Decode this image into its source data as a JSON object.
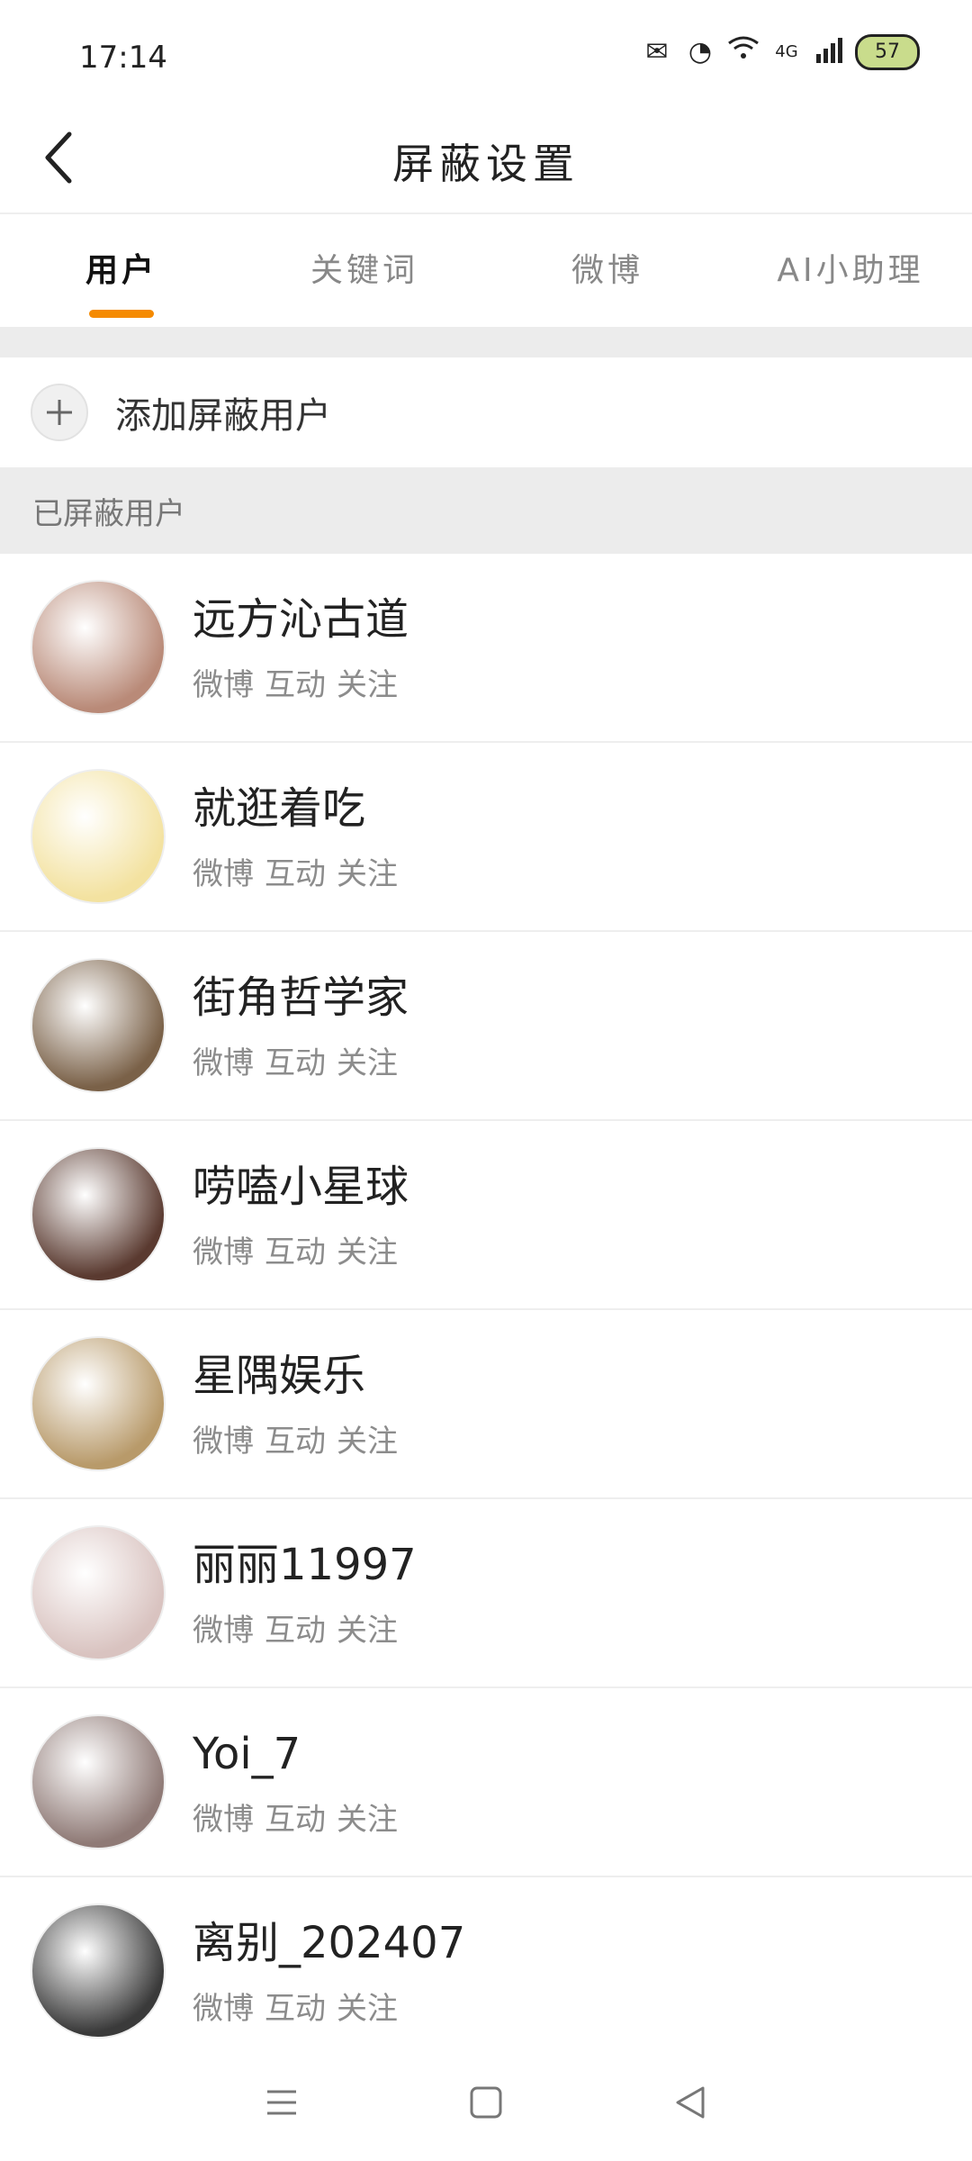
{
  "status_bar": {
    "time": "17:14",
    "network": "4G",
    "battery": "57",
    "icons": [
      "notification-icon",
      "app-icon",
      "wifi-icon",
      "signal-icon",
      "battery-icon"
    ]
  },
  "header": {
    "title": "屏蔽设置",
    "back_icon": "chevron-left-icon"
  },
  "tabs": [
    {
      "label": "用户",
      "active": true
    },
    {
      "label": "关键词",
      "active": false
    },
    {
      "label": "微博",
      "active": false
    },
    {
      "label": "AI小助理",
      "active": false
    }
  ],
  "add_user": {
    "label": "添加屏蔽用户",
    "icon": "plus-icon"
  },
  "section": {
    "title": "已屏蔽用户"
  },
  "blocked_users": [
    {
      "name": "远方沁古道",
      "tags": [
        "微博",
        "互动",
        "关注"
      ],
      "avatar_color": "#b98a78"
    },
    {
      "name": "就逛着吃",
      "tags": [
        "微博",
        "互动",
        "关注"
      ],
      "avatar_color": "#f3e2a0"
    },
    {
      "name": "街角哲学家",
      "tags": [
        "微博",
        "互动",
        "关注"
      ],
      "avatar_color": "#7a6148"
    },
    {
      "name": "唠嗑小星球",
      "tags": [
        "微博",
        "互动",
        "关注"
      ],
      "avatar_color": "#5a3a30"
    },
    {
      "name": "星隅娱乐",
      "tags": [
        "微博",
        "互动",
        "关注"
      ],
      "avatar_color": "#b89a6a"
    },
    {
      "name": "丽丽11997",
      "tags": [
        "微博",
        "互动",
        "关注"
      ],
      "avatar_color": "#d9c3c0"
    },
    {
      "name": "Yoi_7",
      "tags": [
        "微博",
        "互动",
        "关注"
      ],
      "avatar_color": "#8f7a76"
    },
    {
      "name": "离别_202407",
      "tags": [
        "微博",
        "互动",
        "关注"
      ],
      "avatar_color": "#3a3a3a"
    }
  ],
  "nav": {
    "menu_icon": "menu-icon",
    "home_icon": "home-square-icon",
    "back_icon": "back-triangle-icon"
  }
}
